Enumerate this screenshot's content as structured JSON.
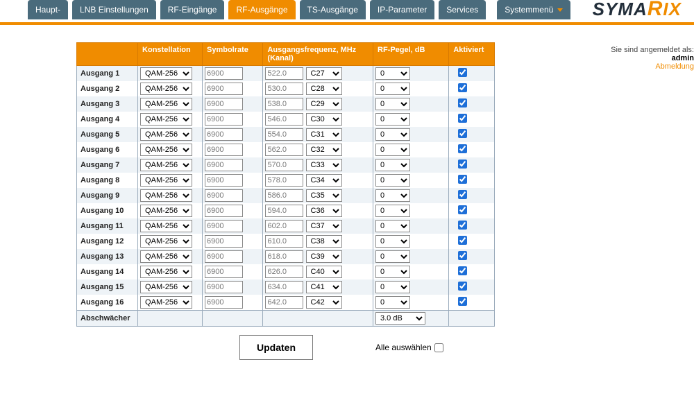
{
  "tabs": {
    "t0": "Haupt-",
    "t1": "LNB Einstellungen",
    "t2": "RF-Eingänge",
    "t3": "RF-Ausgänge",
    "t4": "TS-Ausgänge",
    "t5": "IP-Parameter",
    "t6": "Services",
    "t7": "Systemmenü"
  },
  "logo": {
    "p1": "SYM",
    "p2": "A",
    "p3": "R",
    "p4": "IX"
  },
  "side": {
    "loginPrefix": "Sie sind angemeldet als: ",
    "user": "admin",
    "logout": "Abmeldung"
  },
  "headers": {
    "c0": "",
    "c1": "Konstellation",
    "c2": "Symbolrate",
    "c3": "Ausgangsfrequenz, MHz (Kanal)",
    "c4": "RF-Pegel, dB",
    "c5": "Aktiviert"
  },
  "rows": [
    {
      "name": "Ausgang 1",
      "con": "QAM-256",
      "sr": "6900",
      "freq": "522.0",
      "ch": "C27",
      "peg": "0",
      "akt": true
    },
    {
      "name": "Ausgang 2",
      "con": "QAM-256",
      "sr": "6900",
      "freq": "530.0",
      "ch": "C28",
      "peg": "0",
      "akt": true
    },
    {
      "name": "Ausgang 3",
      "con": "QAM-256",
      "sr": "6900",
      "freq": "538.0",
      "ch": "C29",
      "peg": "0",
      "akt": true
    },
    {
      "name": "Ausgang 4",
      "con": "QAM-256",
      "sr": "6900",
      "freq": "546.0",
      "ch": "C30",
      "peg": "0",
      "akt": true
    },
    {
      "name": "Ausgang 5",
      "con": "QAM-256",
      "sr": "6900",
      "freq": "554.0",
      "ch": "C31",
      "peg": "0",
      "akt": true
    },
    {
      "name": "Ausgang 6",
      "con": "QAM-256",
      "sr": "6900",
      "freq": "562.0",
      "ch": "C32",
      "peg": "0",
      "akt": true
    },
    {
      "name": "Ausgang 7",
      "con": "QAM-256",
      "sr": "6900",
      "freq": "570.0",
      "ch": "C33",
      "peg": "0",
      "akt": true
    },
    {
      "name": "Ausgang 8",
      "con": "QAM-256",
      "sr": "6900",
      "freq": "578.0",
      "ch": "C34",
      "peg": "0",
      "akt": true
    },
    {
      "name": "Ausgang 9",
      "con": "QAM-256",
      "sr": "6900",
      "freq": "586.0",
      "ch": "C35",
      "peg": "0",
      "akt": true
    },
    {
      "name": "Ausgang 10",
      "con": "QAM-256",
      "sr": "6900",
      "freq": "594.0",
      "ch": "C36",
      "peg": "0",
      "akt": true
    },
    {
      "name": "Ausgang 11",
      "con": "QAM-256",
      "sr": "6900",
      "freq": "602.0",
      "ch": "C37",
      "peg": "0",
      "akt": true
    },
    {
      "name": "Ausgang 12",
      "con": "QAM-256",
      "sr": "6900",
      "freq": "610.0",
      "ch": "C38",
      "peg": "0",
      "akt": true
    },
    {
      "name": "Ausgang 13",
      "con": "QAM-256",
      "sr": "6900",
      "freq": "618.0",
      "ch": "C39",
      "peg": "0",
      "akt": true
    },
    {
      "name": "Ausgang 14",
      "con": "QAM-256",
      "sr": "6900",
      "freq": "626.0",
      "ch": "C40",
      "peg": "0",
      "akt": true
    },
    {
      "name": "Ausgang 15",
      "con": "QAM-256",
      "sr": "6900",
      "freq": "634.0",
      "ch": "C41",
      "peg": "0",
      "akt": true
    },
    {
      "name": "Ausgang 16",
      "con": "QAM-256",
      "sr": "6900",
      "freq": "642.0",
      "ch": "C42",
      "peg": "0",
      "akt": true
    }
  ],
  "attRow": {
    "name": "Abschwächer",
    "value": "3.0 dB"
  },
  "buttons": {
    "update": "Updaten"
  },
  "selectAll": {
    "label": "Alle auswählen",
    "checked": false
  }
}
